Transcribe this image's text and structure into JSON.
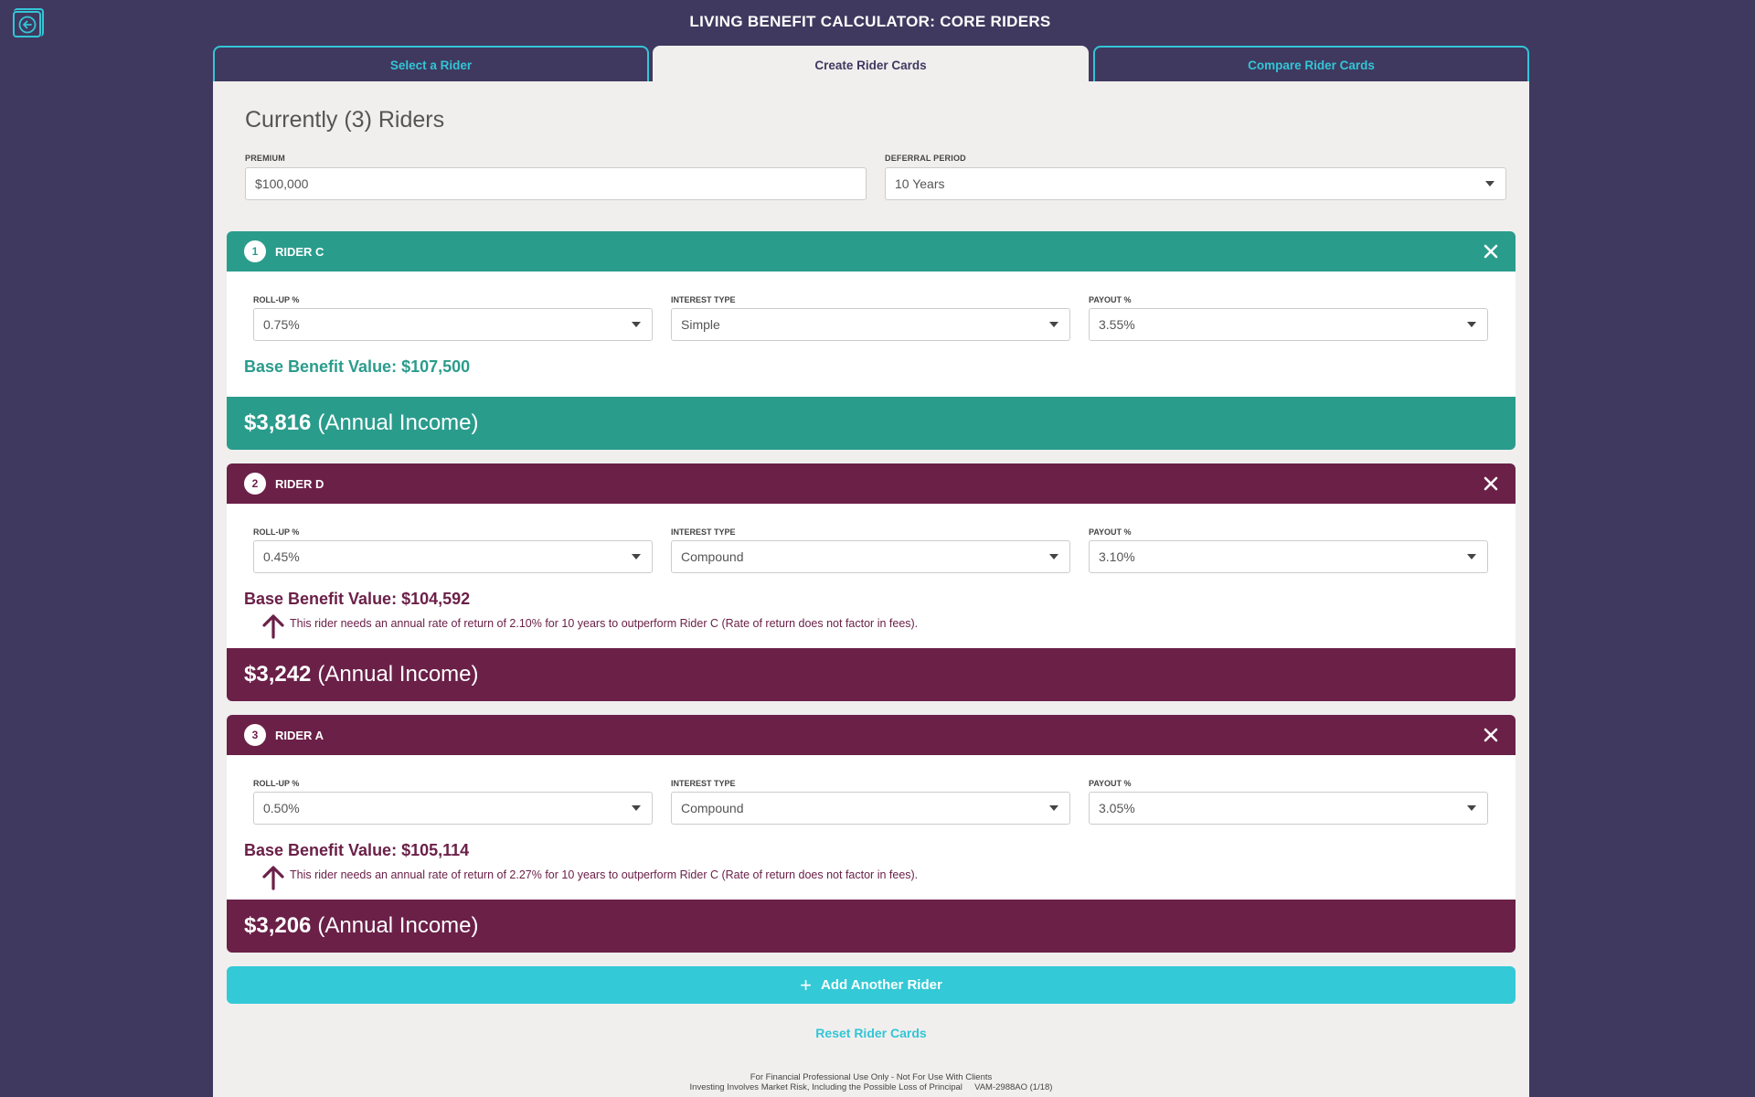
{
  "app": {
    "title": "LIVING BENEFIT CALCULATOR: CORE RIDERS"
  },
  "tabs": [
    {
      "label": "Select a Rider",
      "active": false
    },
    {
      "label": "Create Rider Cards",
      "active": true
    },
    {
      "label": "Compare Rider Cards",
      "active": false
    }
  ],
  "main": {
    "heading": "Currently (3) Riders",
    "premium": {
      "label": "PREMIUM",
      "value": "$100,000"
    },
    "deferral": {
      "label": "DEFERRAL PERIOD",
      "value": "10 Years"
    }
  },
  "field_labels": {
    "rollup": "ROLL-UP %",
    "interest": "INTEREST TYPE",
    "payout": "PAYOUT %"
  },
  "riders": [
    {
      "number": "1",
      "name": "RIDER C",
      "rollup": "0.75%",
      "interest": "Simple",
      "payout": "3.55%",
      "base_value": "Base Benefit Value: $107,500",
      "note": "",
      "income_amount": "$3,816",
      "income_label": "(Annual Income)",
      "color": "#2a9c8c"
    },
    {
      "number": "2",
      "name": "RIDER D",
      "rollup": "0.45%",
      "interest": "Compound",
      "payout": "3.10%",
      "base_value": "Base Benefit Value: $104,592",
      "note": "This rider needs an annual rate of return of 2.10% for 10 years to outperform Rider C (Rate of return does not factor in fees).",
      "income_amount": "$3,242",
      "income_label": "(Annual Income)",
      "color": "#6b2048"
    },
    {
      "number": "3",
      "name": "RIDER A",
      "rollup": "0.50%",
      "interest": "Compound",
      "payout": "3.05%",
      "base_value": "Base Benefit Value: $105,114",
      "note": "This rider needs an annual rate of return of 2.27% for 10 years to outperform Rider C (Rate of return does not factor in fees).",
      "income_amount": "$3,206",
      "income_label": "(Annual Income)",
      "color": "#6b2048"
    }
  ],
  "actions": {
    "add_rider": "Add Another Rider",
    "reset": "Reset Rider Cards"
  },
  "footer": {
    "line1": "For Financial Professional Use Only - Not For Use With Clients",
    "line2": "Investing Involves Market Risk, Including the Possible Loss of Principal     VAM-2988AO (1/18)"
  },
  "icons": {
    "back": "back-arrow-icon",
    "close": "close-icon",
    "dropdown": "chevron-down-icon",
    "up_arrow": "arrow-up-icon",
    "plus": "plus-icon"
  },
  "colors": {
    "background": "#3f395f",
    "accent": "#33c5d6",
    "teal": "#2a9c8c",
    "plum": "#6b2048",
    "panel": "#f0efee"
  }
}
